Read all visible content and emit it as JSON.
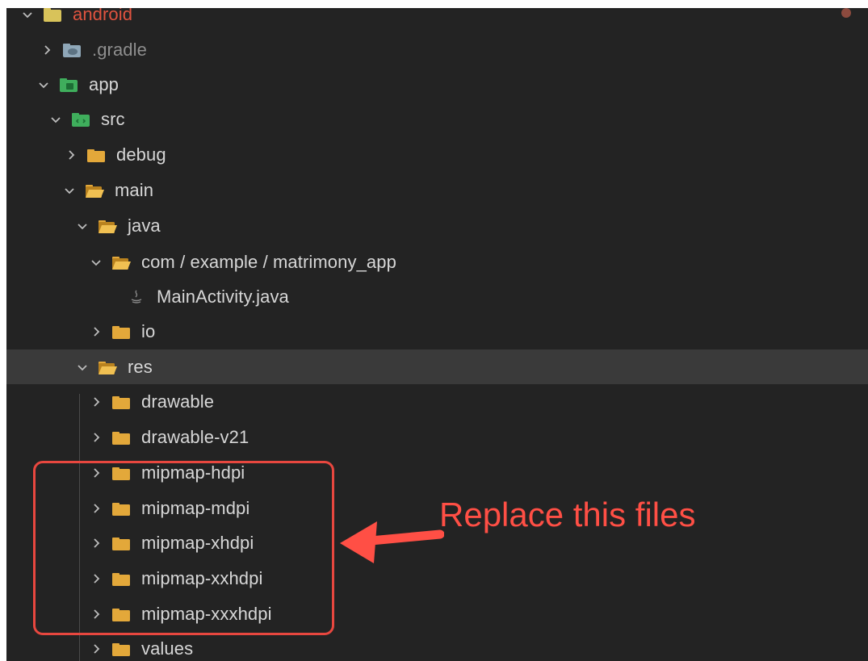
{
  "tree": {
    "items": [
      {
        "label": "android",
        "icon": "android-folder-icon",
        "expanded": true
      },
      {
        "label": ".gradle",
        "icon": "gradle-folder-icon",
        "expanded": false
      },
      {
        "label": "app",
        "icon": "app-folder-icon",
        "expanded": true
      },
      {
        "label": "src",
        "icon": "source-folder-icon",
        "expanded": true
      },
      {
        "label": "debug",
        "icon": "folder-icon",
        "expanded": false
      },
      {
        "label": "main",
        "icon": "open-folder-icon",
        "expanded": true
      },
      {
        "label": "java",
        "icon": "open-folder-icon",
        "expanded": true
      },
      {
        "label": "com / example / matrimony_app",
        "icon": "open-folder-icon",
        "expanded": true
      },
      {
        "label": "MainActivity.java",
        "icon": "java-file-icon"
      },
      {
        "label": "io",
        "icon": "folder-icon",
        "expanded": false
      },
      {
        "label": "res",
        "icon": "open-folder-icon",
        "expanded": true,
        "selected": true
      },
      {
        "label": "drawable",
        "icon": "folder-icon",
        "expanded": false
      },
      {
        "label": "drawable-v21",
        "icon": "folder-icon",
        "expanded": false
      },
      {
        "label": "mipmap-hdpi",
        "icon": "folder-icon",
        "expanded": false
      },
      {
        "label": "mipmap-mdpi",
        "icon": "folder-icon",
        "expanded": false
      },
      {
        "label": "mipmap-xhdpi",
        "icon": "folder-icon",
        "expanded": false
      },
      {
        "label": "mipmap-xxhdpi",
        "icon": "folder-icon",
        "expanded": false
      },
      {
        "label": "mipmap-xxxhdpi",
        "icon": "folder-icon",
        "expanded": false
      },
      {
        "label": "values",
        "icon": "folder-icon",
        "expanded": false
      }
    ]
  },
  "annotation": {
    "text": "Replace this files",
    "color": "#ff4f45"
  },
  "colors": {
    "panel": "#232323",
    "selected_row": "#3a3a3a",
    "folder": "#e3a83a",
    "text": "#d7d7d7"
  }
}
